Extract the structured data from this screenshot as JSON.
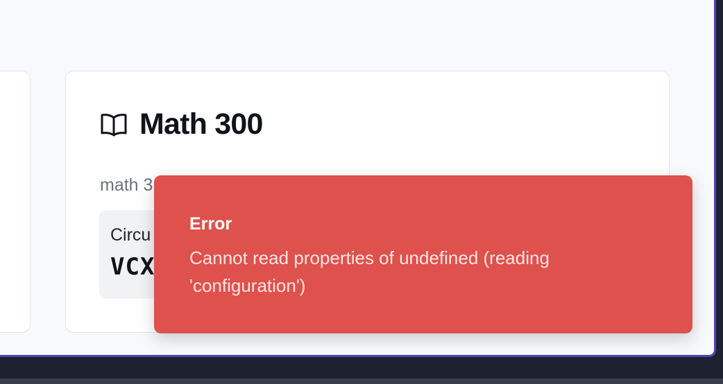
{
  "card": {
    "title": "Math 300",
    "subtitle": "math 3",
    "code_label": "Circu",
    "code_value": "VCX"
  },
  "toast": {
    "title": "Error",
    "message": "Cannot read properties of undefined (reading 'configuration')"
  },
  "icons": {
    "card_icon": "book-open-icon"
  },
  "colors": {
    "toast_background": "#de514c",
    "window_accent_border": "#4f46b8",
    "page_background": "#f8f9fb"
  }
}
